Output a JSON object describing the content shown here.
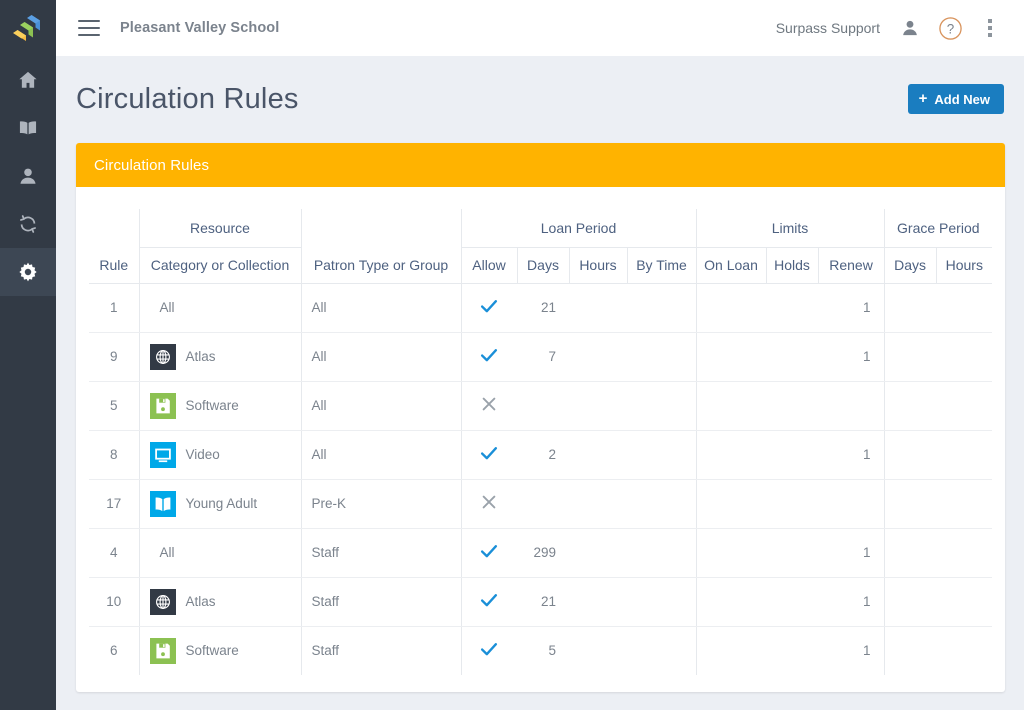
{
  "brand": {
    "logo_icon": "surpass-logo-icon",
    "accent_blue": "#1a7dc0",
    "accent_orange": "#ffb300"
  },
  "sidebar": {
    "items": [
      {
        "icon": "home-icon",
        "name": "sidebar-item-home",
        "active": false
      },
      {
        "icon": "book-icon",
        "name": "sidebar-item-catalog",
        "active": false
      },
      {
        "icon": "person-icon",
        "name": "sidebar-item-patrons",
        "active": false
      },
      {
        "icon": "sync-icon",
        "name": "sidebar-item-circulation",
        "active": false
      },
      {
        "icon": "gear-icon",
        "name": "sidebar-item-settings",
        "active": true
      }
    ]
  },
  "topbar": {
    "menu_icon": "hamburger-icon",
    "school_name": "Pleasant Valley School",
    "support_name": "Surpass Support",
    "account_icon": "person-icon",
    "help_icon": "question-circle-icon",
    "overflow_icon": "kebab-menu-icon"
  },
  "header": {
    "page_title": "Circulation Rules",
    "add_new_label": "Add New",
    "add_new_icon": "plus-icon"
  },
  "card": {
    "title": "Circulation Rules"
  },
  "table": {
    "groups": [
      {
        "label": "",
        "span": 1
      },
      {
        "label": "Resource",
        "span": 1
      },
      {
        "label": "",
        "span": 1
      },
      {
        "label": "Loan Period",
        "span": 4
      },
      {
        "label": "Limits",
        "span": 3
      },
      {
        "label": "Grace Period",
        "span": 2
      }
    ],
    "columns": [
      "Rule",
      "Category or Collection",
      "Patron Type or Group",
      "Allow",
      "Days",
      "Hours",
      "By Time",
      "On Loan",
      "Holds",
      "Renew",
      "Days",
      "Hours"
    ],
    "rows": [
      {
        "rule": "1",
        "category": "All",
        "cat_icon": "",
        "patron": "All",
        "allow": "check",
        "loan_days": "21",
        "loan_hours": "",
        "by_time": "",
        "on_loan": "",
        "holds": "",
        "renew": "1",
        "grace_days": "",
        "grace_hours": ""
      },
      {
        "rule": "9",
        "category": "Atlas",
        "cat_icon": "globe-icon",
        "patron": "All",
        "allow": "check",
        "loan_days": "7",
        "loan_hours": "",
        "by_time": "",
        "on_loan": "",
        "holds": "",
        "renew": "1",
        "grace_days": "",
        "grace_hours": ""
      },
      {
        "rule": "5",
        "category": "Software",
        "cat_icon": "floppy-icon",
        "patron": "All",
        "allow": "cross",
        "loan_days": "",
        "loan_hours": "",
        "by_time": "",
        "on_loan": "",
        "holds": "",
        "renew": "",
        "grace_days": "",
        "grace_hours": ""
      },
      {
        "rule": "8",
        "category": "Video",
        "cat_icon": "monitor-icon",
        "patron": "All",
        "allow": "check",
        "loan_days": "2",
        "loan_hours": "",
        "by_time": "",
        "on_loan": "",
        "holds": "",
        "renew": "1",
        "grace_days": "",
        "grace_hours": ""
      },
      {
        "rule": "17",
        "category": "Young Adult",
        "cat_icon": "openbook-icon",
        "patron": "Pre-K",
        "allow": "cross",
        "loan_days": "",
        "loan_hours": "",
        "by_time": "",
        "on_loan": "",
        "holds": "",
        "renew": "",
        "grace_days": "",
        "grace_hours": ""
      },
      {
        "rule": "4",
        "category": "All",
        "cat_icon": "",
        "patron": "Staff",
        "allow": "check",
        "loan_days": "299",
        "loan_hours": "",
        "by_time": "",
        "on_loan": "",
        "holds": "",
        "renew": "1",
        "grace_days": "",
        "grace_hours": ""
      },
      {
        "rule": "10",
        "category": "Atlas",
        "cat_icon": "globe-icon",
        "patron": "Staff",
        "allow": "check",
        "loan_days": "21",
        "loan_hours": "",
        "by_time": "",
        "on_loan": "",
        "holds": "",
        "renew": "1",
        "grace_days": "",
        "grace_hours": ""
      },
      {
        "rule": "6",
        "category": "Software",
        "cat_icon": "floppy-icon",
        "patron": "Staff",
        "allow": "check",
        "loan_days": "5",
        "loan_hours": "",
        "by_time": "",
        "on_loan": "",
        "holds": "",
        "renew": "1",
        "grace_days": "",
        "grace_hours": ""
      }
    ]
  }
}
